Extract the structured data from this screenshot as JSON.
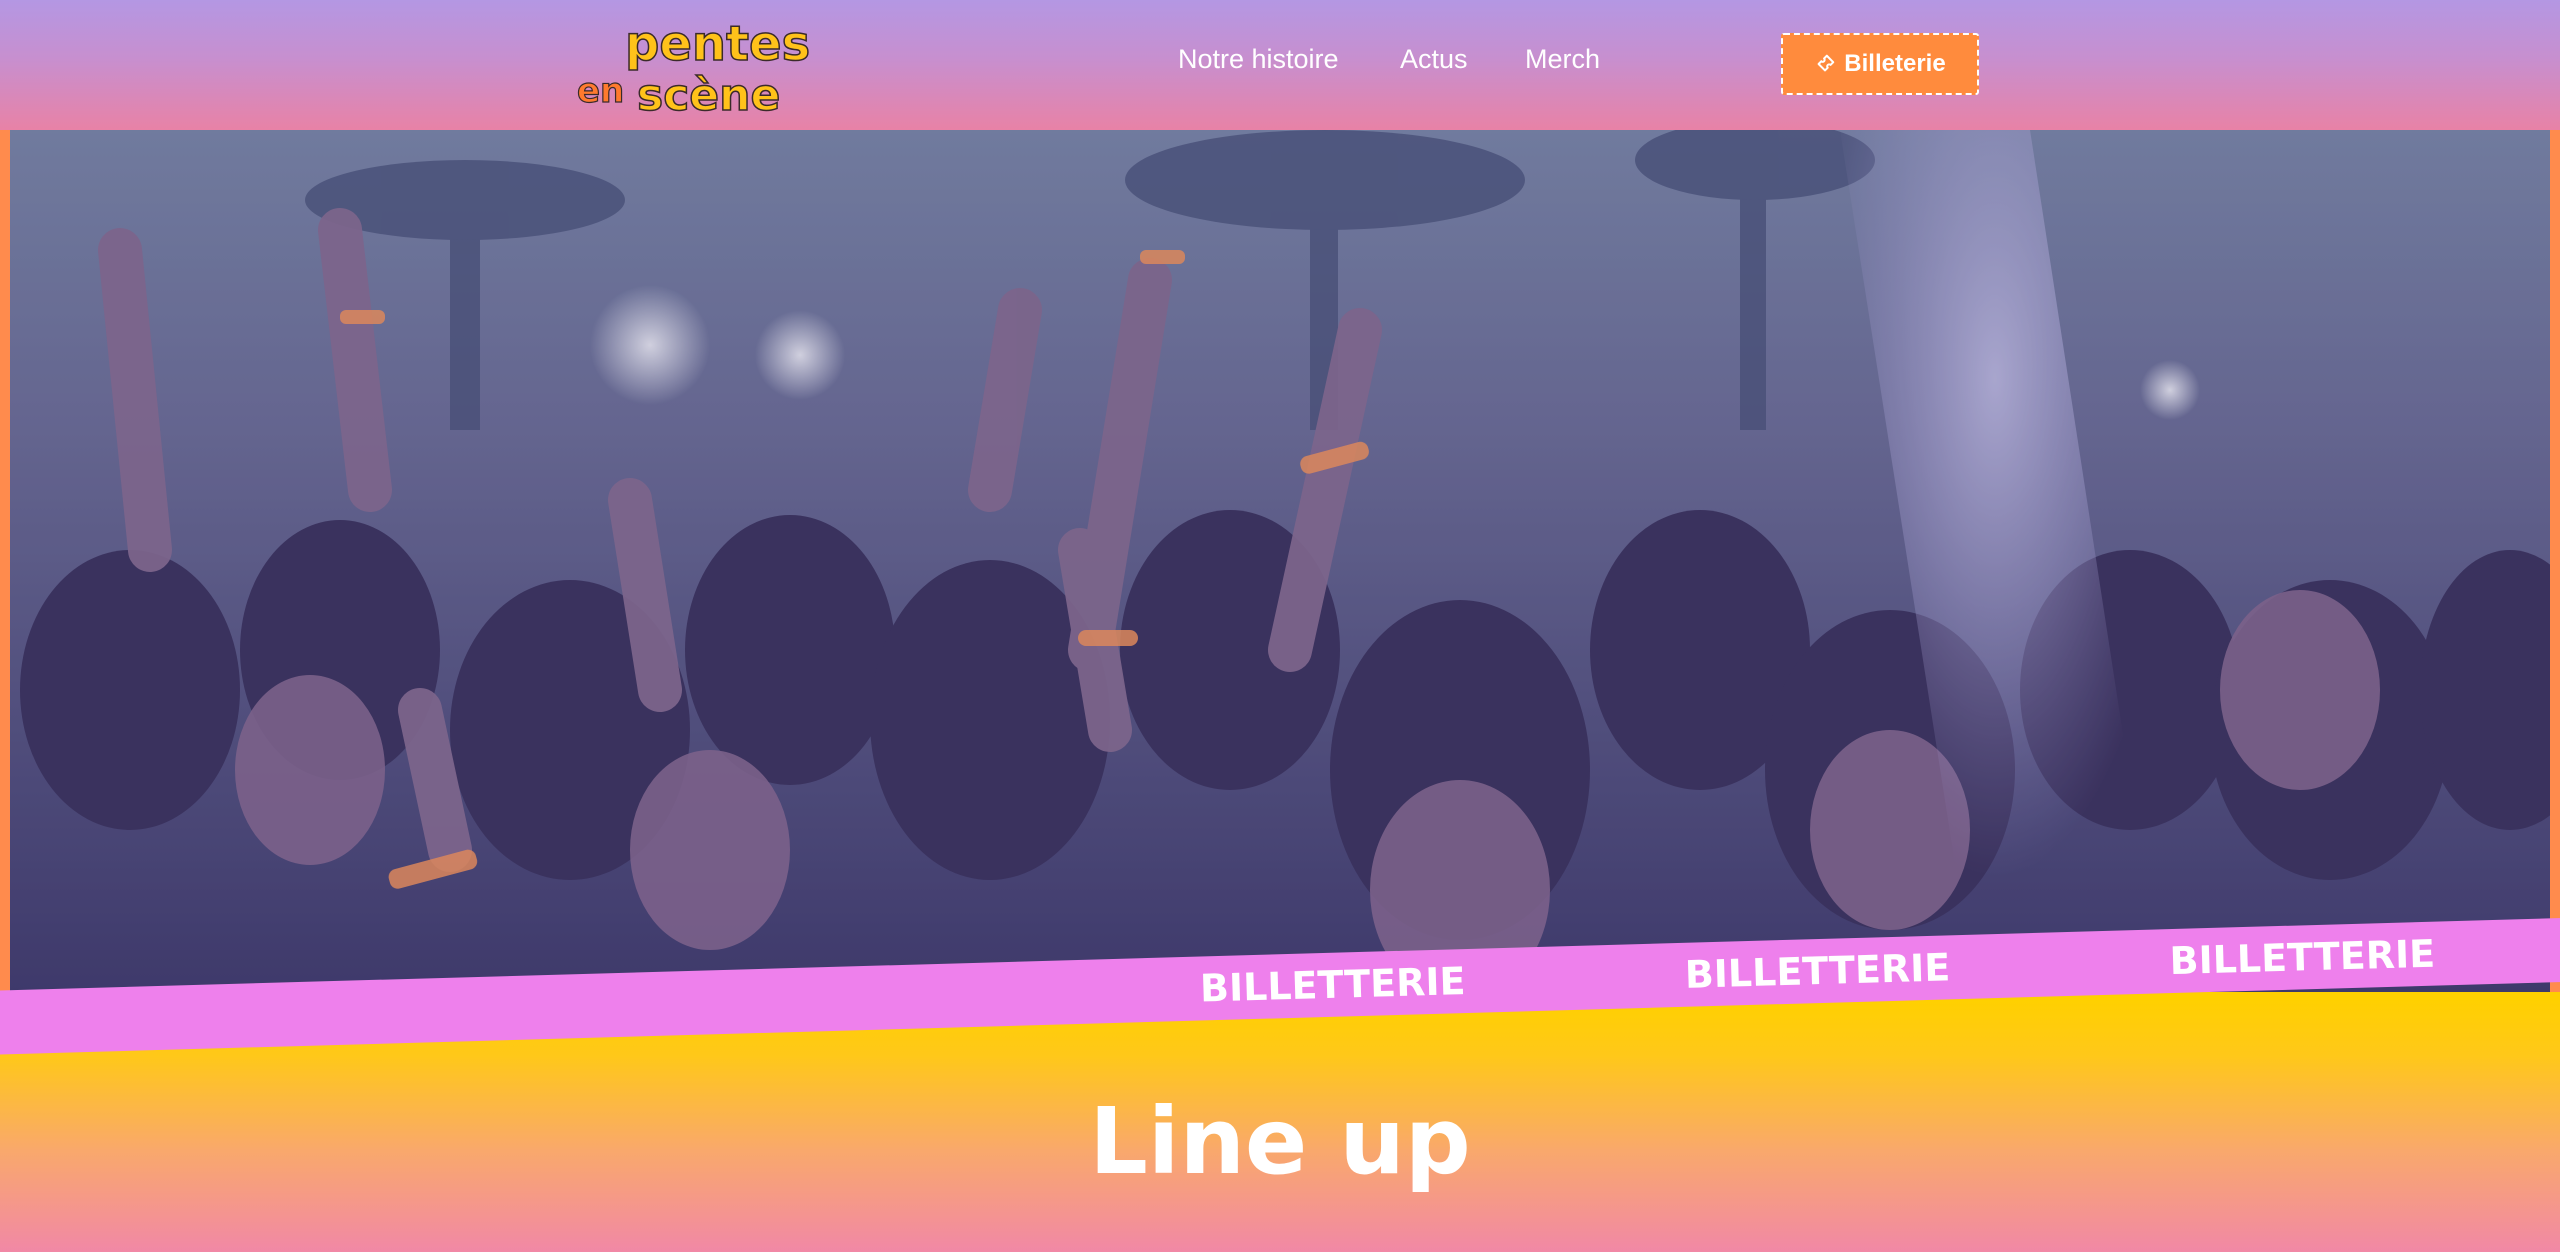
{
  "brand": {
    "logo_line1": "pentes",
    "logo_line2_a": "en",
    "logo_line2_b": "scène",
    "colors": {
      "logo_yellow": "#ffc21a",
      "logo_orange": "#ff7a2e",
      "logo_outline": "#3a2a2a"
    }
  },
  "nav": {
    "items": [
      {
        "label": "Notre histoire"
      },
      {
        "label": "Actus"
      },
      {
        "label": "Merch"
      }
    ]
  },
  "header": {
    "ticket_button_label": "Billeterie",
    "ticket_icon": "ticket-icon"
  },
  "hero": {
    "image_alt": "concert-crowd-photo"
  },
  "ribbon": {
    "items": [
      "BILLETTERIE",
      "BILLETTERIE",
      "BILLETTERIE"
    ]
  },
  "lineup": {
    "title": "Line up"
  },
  "colors": {
    "header_top": "#b497e3",
    "header_bottom": "#e882a6",
    "button": "#ff8b3d",
    "ribbon": "#ee80ec",
    "lineup_top": "#ffd000",
    "lineup_bottom": "#f188a6"
  }
}
